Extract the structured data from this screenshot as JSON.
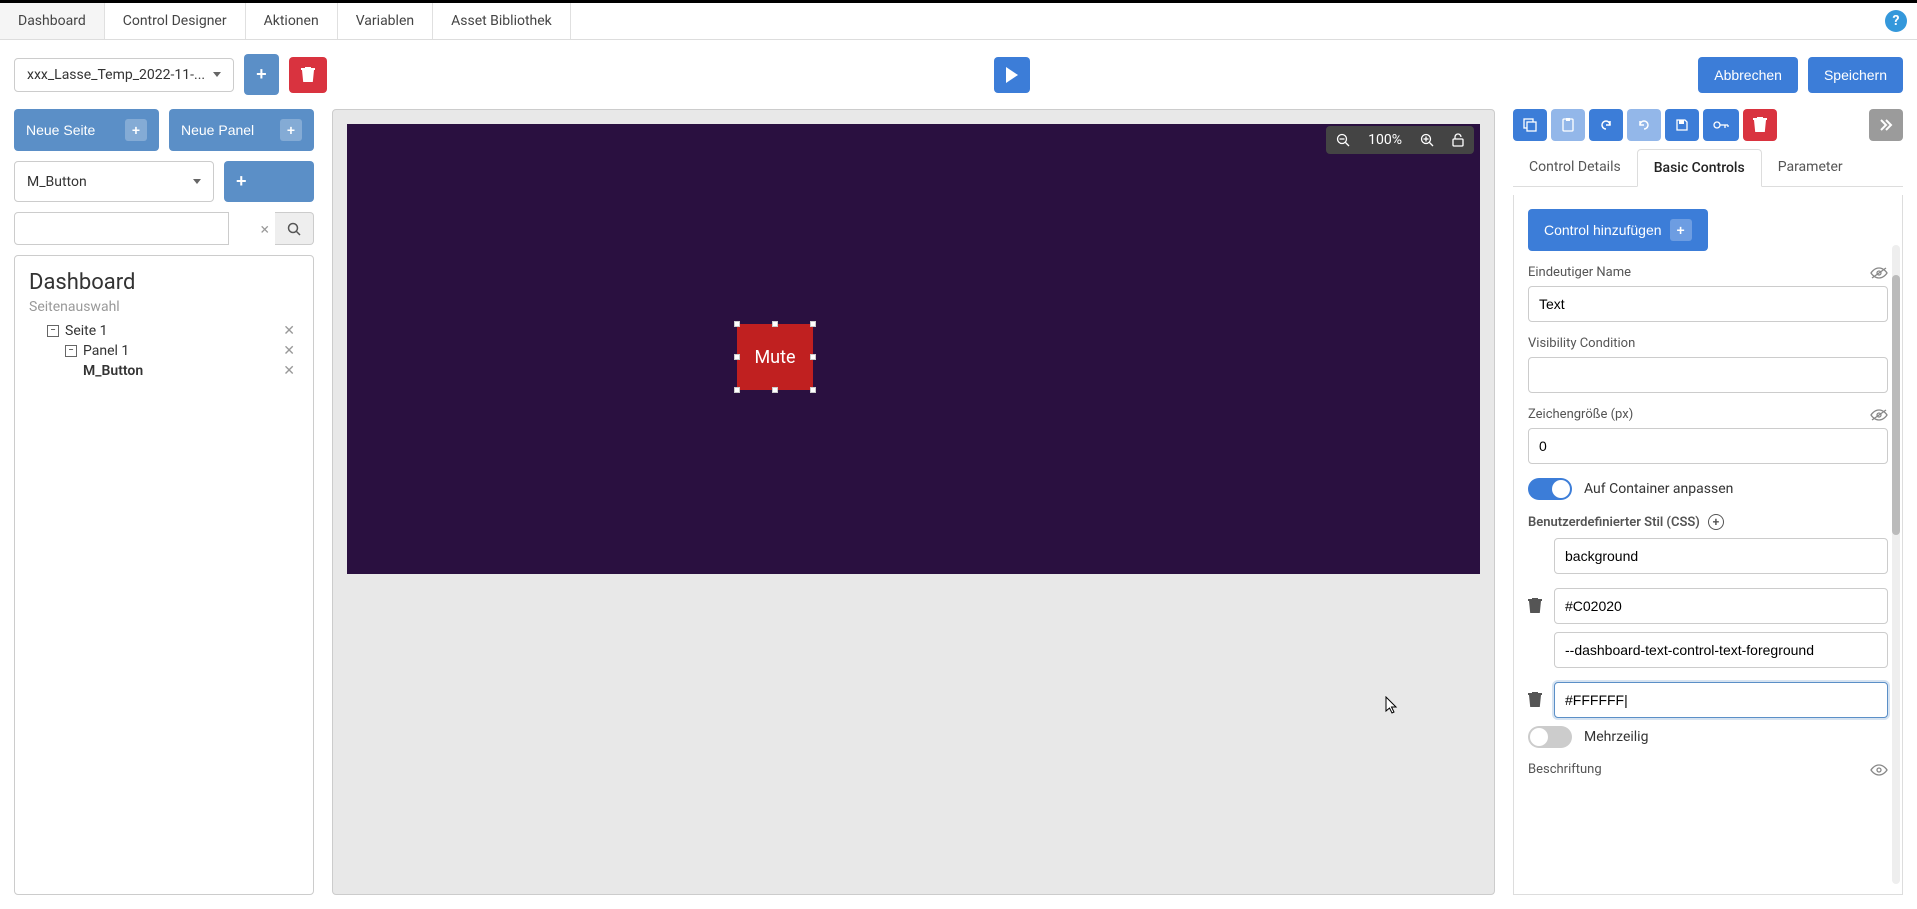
{
  "menu": {
    "items": [
      "Dashboard",
      "Control Designer",
      "Aktionen",
      "Variablen",
      "Asset Bibliothek"
    ],
    "activeIndex": 0
  },
  "toolbar": {
    "dashboard_dropdown": "xxx_Lasse_Temp_2022-11-...",
    "cancel_label": "Abbrechen",
    "save_label": "Speichern"
  },
  "left": {
    "new_page_label": "Neue Seite",
    "new_panel_label": "Neue Panel",
    "control_dropdown": "M_Button",
    "tree": {
      "title": "Dashboard",
      "sub": "Seitenauswahl",
      "page": "Seite 1",
      "panel": "Panel 1",
      "control": "M_Button"
    }
  },
  "canvas": {
    "zoom": "100%",
    "element_text": "Mute"
  },
  "right": {
    "tabs": [
      "Control Details",
      "Basic Controls",
      "Parameter"
    ],
    "activeTab": 1,
    "add_control_label": "Control hinzufügen",
    "fields": {
      "unique_name_label": "Eindeutiger Name",
      "unique_name_value": "Text",
      "visibility_label": "Visibility Condition",
      "visibility_value": "",
      "charsize_label": "Zeichengröße (px)",
      "charsize_value": "0",
      "fit_container_label": "Auf Container anpassen",
      "fit_container_on": true,
      "css_label": "Benutzerdefinierter Stil (CSS)",
      "css_rows": [
        {
          "prop": "background",
          "value": "#C02020"
        },
        {
          "prop": "--dashboard-text-control-text-foreground",
          "value": "#FFFFFF|"
        }
      ],
      "multiline_label": "Mehrzeilig",
      "multiline_on": false,
      "caption_label": "Beschriftung"
    }
  }
}
